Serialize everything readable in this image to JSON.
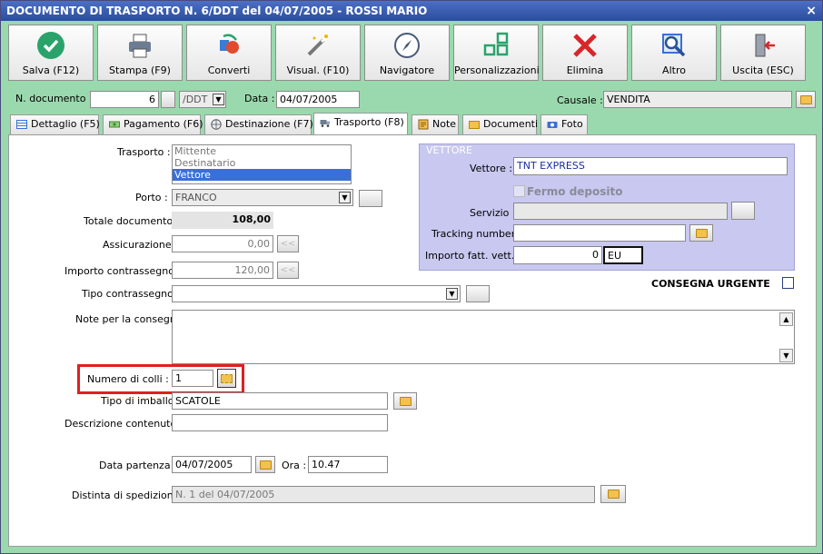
{
  "window": {
    "title": "DOCUMENTO DI TRASPORTO N. 6/DDT del 04/07/2005 - ROSSI MARIO",
    "close_label": "×"
  },
  "toolbar": [
    {
      "label": "Salva (F12)",
      "icon": "check-circle-icon"
    },
    {
      "label": "Stampa (F9)",
      "icon": "printer-icon"
    },
    {
      "label": "Converti",
      "icon": "convert-icon"
    },
    {
      "label": "Visual. (F10)",
      "icon": "magic-wand-icon"
    },
    {
      "label": "Navigatore",
      "icon": "compass-icon"
    },
    {
      "label": "Personalizzazioni",
      "icon": "grid-squares-icon"
    },
    {
      "label": "Elimina",
      "icon": "red-x-icon"
    },
    {
      "label": "Altro",
      "icon": "magnifier-icon"
    },
    {
      "label": "Uscita (ESC)",
      "icon": "exit-door-icon"
    }
  ],
  "header": {
    "n_documento_label": "N. documento :",
    "n_documento": "6",
    "serie": "/DDT",
    "data_label": "Data :",
    "data": "04/07/2005",
    "causale_label": "Causale :",
    "causale": "VENDITA"
  },
  "tabs": [
    {
      "label": "Dettaglio (F5)"
    },
    {
      "label": "Pagamento (F6)"
    },
    {
      "label": "Destinazione (F7)"
    },
    {
      "label": "Trasporto (F8)"
    },
    {
      "label": "Note"
    },
    {
      "label": "Documenti"
    },
    {
      "label": "Foto"
    }
  ],
  "trasporto": {
    "trasporto_label": "Trasporto :",
    "trasporto_options": [
      "Mittente",
      "Destinatario",
      "Vettore"
    ],
    "porto_label": "Porto :",
    "porto": "FRANCO",
    "totale_label": "Totale documento :",
    "totale": "108,00",
    "assicurazione_label": "Assicurazione :",
    "assicurazione": "0,00",
    "contrassegno_label": "Importo contrassegno :",
    "contrassegno": "120,00",
    "tipo_contrassegno_label": "Tipo contrassegno :",
    "tipo_contrassegno": "",
    "note_label": "Note per la consegna",
    "note": "",
    "colli_label": "Numero di colli :",
    "colli": "1",
    "imballo_label": "Tipo di imballo :",
    "imballo": "SCATOLE",
    "descrizione_label": "Descrizione contenuto :",
    "descrizione": "",
    "data_partenza_label": "Data partenza :",
    "data_partenza": "04/07/2005",
    "ora_label": "Ora :",
    "ora": "10.47",
    "distinta_label": "Distinta di spedizione :",
    "distinta": "N.  1 del 04/07/2005",
    "arrow_label": "<<"
  },
  "vettore": {
    "title": "VETTORE",
    "vettore_label": "Vettore :",
    "vettore": "TNT EXPRESS",
    "fermo_label": "Fermo deposito",
    "servizio_label": "Servizio :",
    "servizio": "",
    "tracking_label": "Tracking number :",
    "tracking": "",
    "importo_label": "Importo fatt. vett.",
    "importo": "0",
    "valuta": "EU",
    "consegna_label": "CONSEGNA URGENTE"
  },
  "colors": {
    "accent_green": "#9ad9ad",
    "vettore_panel": "#c8c8f0",
    "highlight_red": "#e0201f",
    "selection_blue": "#3a6fd8"
  }
}
